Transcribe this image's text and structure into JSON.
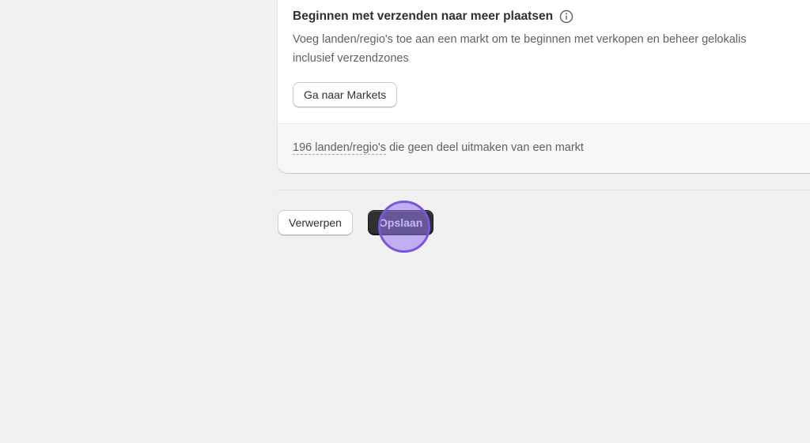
{
  "markets_card": {
    "title": "Beginnen met verzenden naar meer plaatsen",
    "description_line1": "Voeg landen/regio's toe aan een markt om te beginnen met verkopen en beheer gelokalis",
    "description_line2": "inclusief verzendzones",
    "button_label": "Ga naar Markets",
    "footer_link": "196 landen/regio's",
    "footer_text": " die geen deel uitmaken van een markt"
  },
  "actions": {
    "discard_label": "Verwerpen",
    "save_label": "Opslaan"
  },
  "icons": {
    "info": "info-icon"
  },
  "colors": {
    "background": "#f1f1f1",
    "card": "#ffffff",
    "card_footer": "#f7f7f7",
    "primary_button": "#303030",
    "click_indicator": "#7b55e0"
  }
}
